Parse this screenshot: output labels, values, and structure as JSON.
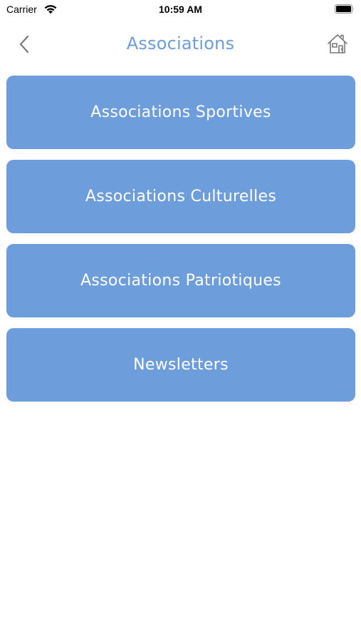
{
  "status_bar": {
    "carrier": "Carrier",
    "time": "10:59 AM",
    "wifi_icon": "wifi-icon",
    "battery_icon": "battery-icon"
  },
  "nav": {
    "title": "Associations",
    "back_icon": "chevron-left-icon",
    "home_icon": "home-icon"
  },
  "menu": {
    "items": [
      {
        "label": "Associations Sportives"
      },
      {
        "label": "Associations Culturelles"
      },
      {
        "label": "Associations Patriotiques"
      },
      {
        "label": "Newsletters"
      }
    ]
  },
  "colors": {
    "accent": "#6d9ddb",
    "button_text": "#ffffff",
    "background": "#ffffff"
  }
}
